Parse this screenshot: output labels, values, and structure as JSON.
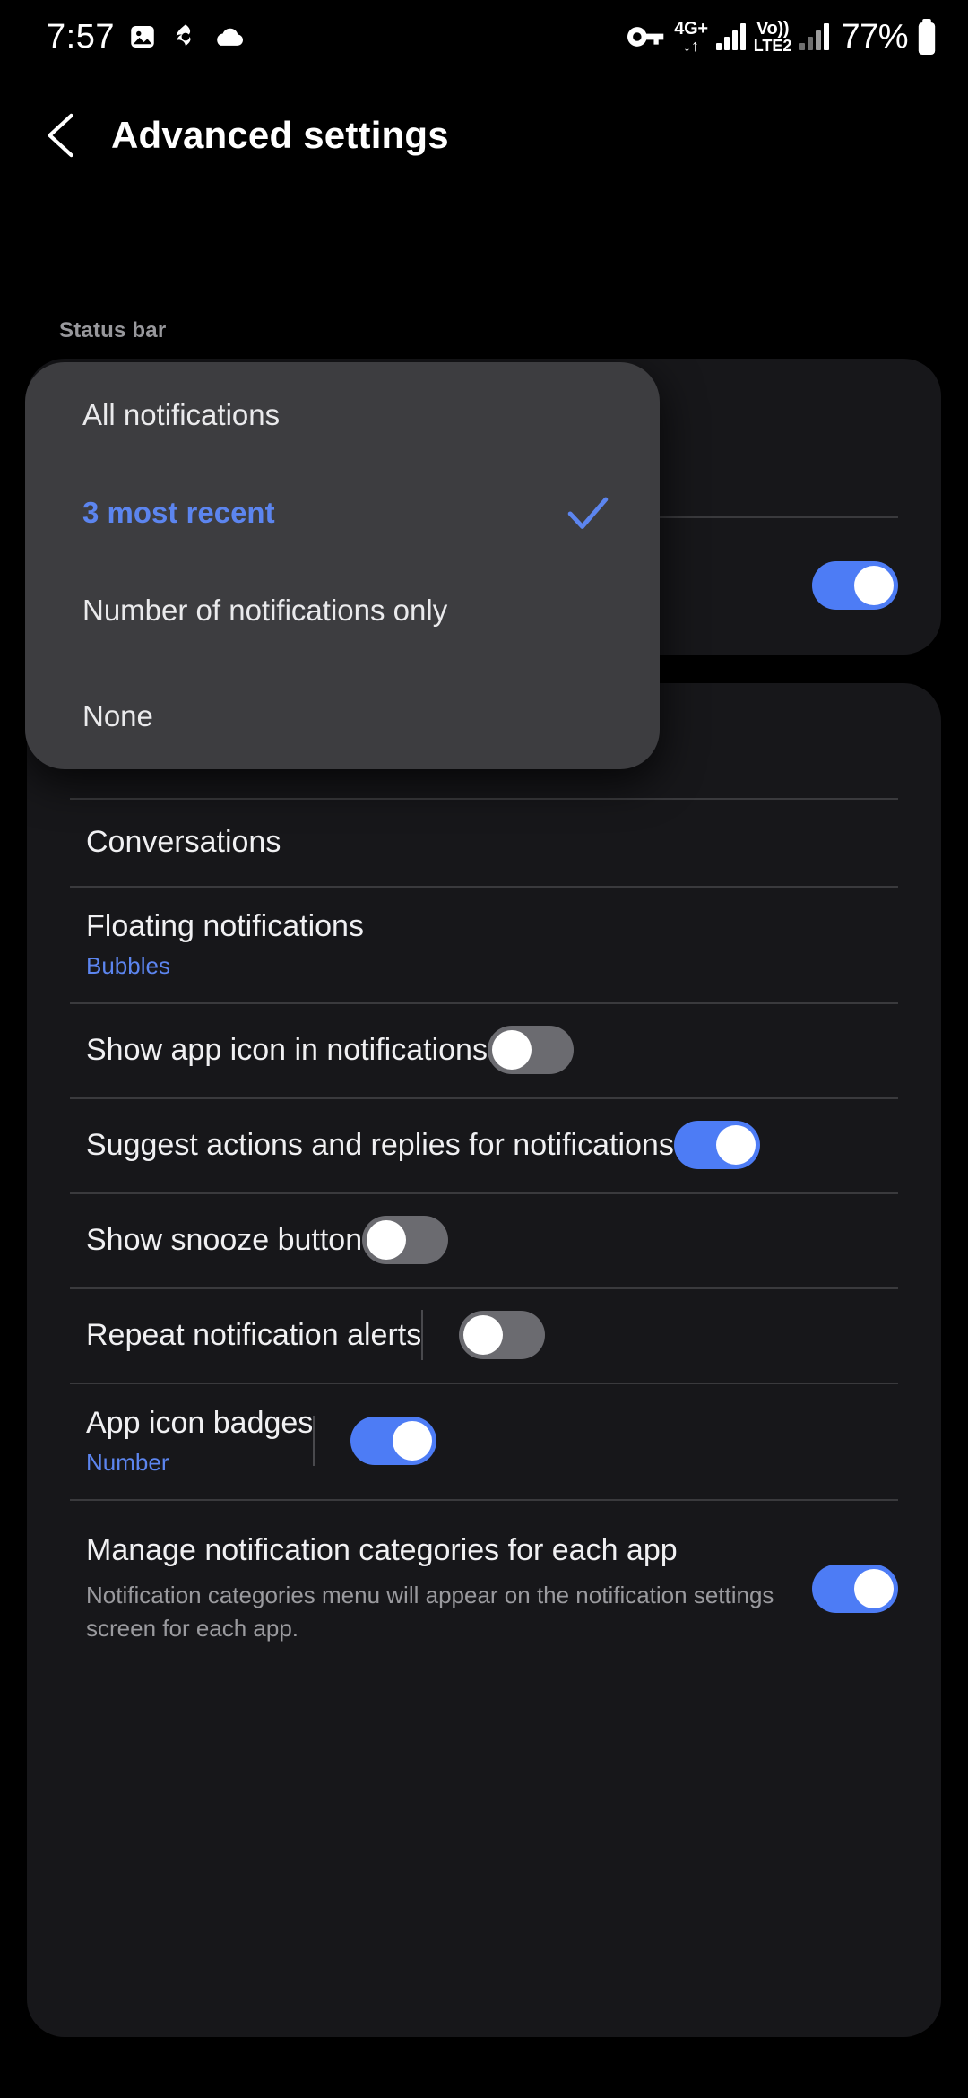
{
  "status_bar": {
    "time": "7:57",
    "left_icons": [
      "image-icon",
      "photo-share-icon",
      "cloud-icon"
    ],
    "vpn_key_icon": "vpn-key-icon",
    "network_top": "4G+",
    "network_arrows": "↓↑",
    "volte_top": "Vo))",
    "volte_bottom": "LTE2",
    "battery_percent": "77%",
    "battery_icon": "battery-icon"
  },
  "header": {
    "back_icon": "back-chevron-icon",
    "title": "Advanced settings"
  },
  "sections": {
    "status_bar_label": "Status bar"
  },
  "dialog": {
    "name": "status-bar-notifications-dialog",
    "selected_index": 1,
    "check_icon": "check-icon",
    "options": [
      {
        "label": "All notifications",
        "selected": false
      },
      {
        "label": "3 most recent",
        "selected": true
      },
      {
        "label": "Number of notifications only",
        "selected": false
      },
      {
        "label": "None",
        "selected": false
      }
    ]
  },
  "card_top": {
    "rows": [
      {
        "name": "hidden-row-1",
        "title": "",
        "subtitle": "",
        "toggle": null
      },
      {
        "name": "hidden-row-2",
        "title": "",
        "subtitle": "",
        "toggle": "on"
      }
    ]
  },
  "card_main": {
    "rows": [
      {
        "name": "notification-history",
        "title": "",
        "subtitle": "",
        "toggle": null,
        "has_divider": false
      },
      {
        "name": "conversations",
        "title": "Conversations",
        "subtitle": "",
        "toggle": null,
        "has_divider": true
      },
      {
        "name": "floating-notifications",
        "title": "Floating notifications",
        "subtitle": "Bubbles",
        "subtitle_style": "blue",
        "toggle": null,
        "has_divider": true
      },
      {
        "name": "show-app-icon-in-notifications",
        "title": "Show app icon in notifications",
        "subtitle": "",
        "toggle": "off",
        "has_divider": true
      },
      {
        "name": "suggest-actions-and-replies",
        "title": "Suggest actions and replies for notifications",
        "subtitle": "",
        "toggle": "on",
        "has_divider": true
      },
      {
        "name": "show-snooze-button",
        "title": "Show snooze button",
        "subtitle": "",
        "toggle": "off",
        "has_divider": true
      },
      {
        "name": "repeat-notification-alerts",
        "title": "Repeat notification alerts",
        "subtitle": "",
        "toggle": "off",
        "toggle_divider": true,
        "has_divider": true
      },
      {
        "name": "app-icon-badges",
        "title": "App icon badges",
        "subtitle": "Number",
        "subtitle_style": "blue",
        "toggle": "on",
        "toggle_divider": true,
        "has_divider": true
      },
      {
        "name": "manage-notification-categories",
        "title": "Manage notification categories for each app",
        "subtitle": "Notification categories menu will appear on the notification settings screen for each app.",
        "subtitle_style": "grey",
        "toggle": "on",
        "has_divider": true
      }
    ]
  },
  "colors": {
    "background": "#000000",
    "card": "#17171a",
    "dialog": "#3d3d40",
    "accent_blue": "#5c85ef",
    "toggle_on": "#4d7cf5",
    "toggle_off": "#6b6b70",
    "divider": "#3a3a3d",
    "text_primary": "#f0f0f2",
    "text_secondary": "#9a9a9e"
  }
}
